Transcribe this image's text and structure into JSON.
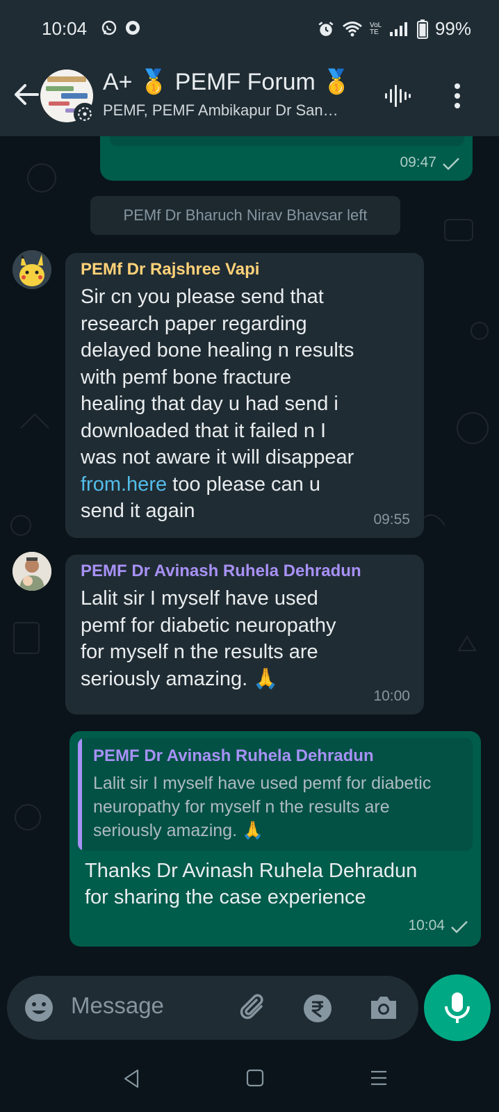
{
  "status_bar": {
    "time": "10:04",
    "battery": "99%",
    "network": "VoLTE"
  },
  "header": {
    "title": "A+ 🥇 PEMF Forum 🥇",
    "subtitle": "PEMF, PEMF Ambikapur Dr San…"
  },
  "messages": {
    "prev_time": "09:47",
    "system_notice": "PEMf Dr Bharuch Nirav Bhavsar left",
    "msg1": {
      "sender": "PEMf Dr Rajshree Vapi",
      "sender_color": "#ffd279",
      "lines": [
        "Sir cn you please send that",
        "research paper regarding",
        "delayed bone healing n results",
        "with pemf bone fracture",
        "healing that day u had send i",
        "downloaded that it failed n I",
        "was not aware it will disappear"
      ],
      "link_text": "from.here",
      "after_link": " too please can u",
      "last_line": "send it again",
      "time": "09:55"
    },
    "msg2": {
      "sender": "PEMF Dr Avinash Ruhela Dehradun",
      "sender_color": "#a791f6",
      "lines": [
        "Lalit sir I myself have used",
        "pemf for diabetic neuropathy",
        "for myself n the results are",
        "seriously amazing. 🙏"
      ],
      "time": "10:00"
    },
    "msg3": {
      "quote_sender": "PEMF Dr Avinash Ruhela Dehradun",
      "quote_text": "Lalit sir I myself have used pemf for diabetic neuropathy for myself n the results are seriously amazing. 🙏",
      "lines": [
        "Thanks Dr Avinash Ruhela Dehradun",
        "for sharing the case experience"
      ],
      "time": "10:04"
    }
  },
  "input": {
    "placeholder": "Message"
  },
  "icons": {
    "back": "arrow-left-icon",
    "voice_chat": "voice-chat-icon",
    "menu": "more-vert-icon",
    "emoji": "emoji-icon",
    "attach": "paperclip-icon",
    "payment": "rupee-icon",
    "camera": "camera-icon",
    "mic": "mic-icon"
  },
  "colors": {
    "header_bg": "#1f2c34",
    "chat_bg": "#0b141a",
    "outgoing_bubble": "#005c4b",
    "incoming_bubble": "#202c33",
    "accent": "#00a884",
    "link": "#53bdeb"
  }
}
